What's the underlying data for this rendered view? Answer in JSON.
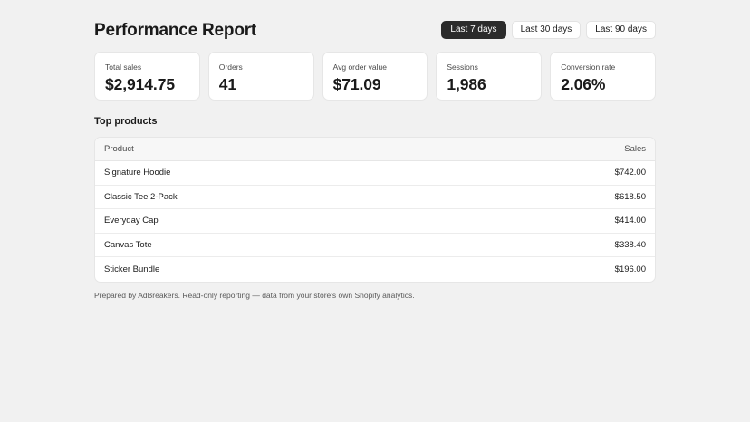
{
  "header": {
    "title": "Performance Report",
    "ranges": [
      {
        "label": "Last 7 days",
        "active": true
      },
      {
        "label": "Last 30 days",
        "active": false
      },
      {
        "label": "Last 90 days",
        "active": false
      }
    ]
  },
  "kpis": [
    {
      "label": "Total sales",
      "value": "$2,914.75"
    },
    {
      "label": "Orders",
      "value": "41"
    },
    {
      "label": "Avg order value",
      "value": "$71.09"
    },
    {
      "label": "Sessions",
      "value": "1,986"
    },
    {
      "label": "Conversion rate",
      "value": "2.06%"
    }
  ],
  "top_products": {
    "title": "Top products",
    "columns": {
      "product": "Product",
      "sales": "Sales"
    },
    "rows": [
      {
        "product": "Signature Hoodie",
        "sales": "$742.00"
      },
      {
        "product": "Classic Tee 2-Pack",
        "sales": "$618.50"
      },
      {
        "product": "Everyday Cap",
        "sales": "$414.00"
      },
      {
        "product": "Canvas Tote",
        "sales": "$338.40"
      },
      {
        "product": "Sticker Bundle",
        "sales": "$196.00"
      }
    ]
  },
  "footer": {
    "note": "Prepared by AdBreakers. Read-only reporting — data from your store's own Shopify analytics."
  },
  "colors": {
    "background": "#f1f1f1",
    "active_button": "#2b2b2b",
    "card": "#ffffff"
  }
}
